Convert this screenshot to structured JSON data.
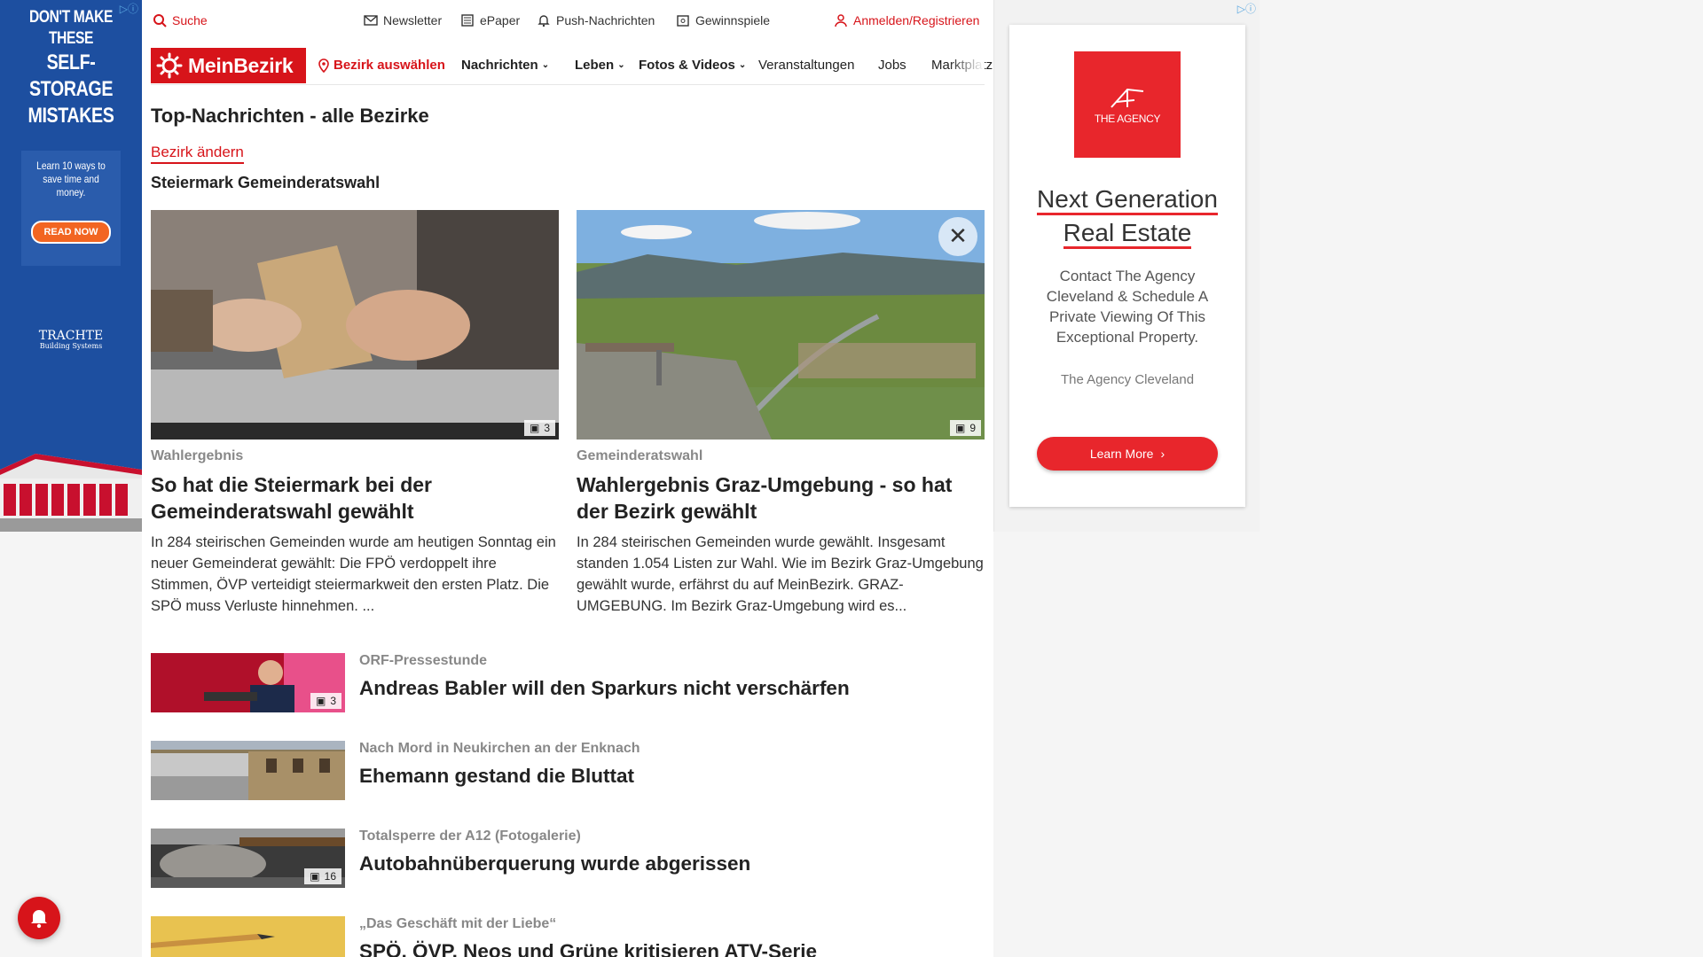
{
  "left_ad": {
    "adchoice": "▷ⓘ",
    "headline_line1": "DON'T MAKE THESE",
    "headline_line2": "SELF-STORAGE",
    "headline_line3": "MISTAKES",
    "promo_text": "Learn 10 ways to save time and money.",
    "cta": "READ NOW",
    "brand": "TRACHTE",
    "brand_sub": "Building Systems"
  },
  "topbar": {
    "search": "Suche",
    "newsletter": "Newsletter",
    "epaper": "ePaper",
    "push": "Push-Nachrichten",
    "gewinnspiele": "Gewinnspiele",
    "login": "Anmelden/Registrieren"
  },
  "nav": {
    "logo": "MeinBezirk",
    "bezirk": "Bezirk auswählen",
    "items": [
      "Nachrichten",
      "Leben",
      "Fotos & Videos",
      "Veranstaltungen",
      "Jobs",
      "Marktplatz"
    ]
  },
  "page": {
    "title": "Top-Nachrichten - alle Bezirke",
    "change_link": "Bezirk ändern",
    "section": "Steiermark Gemeinderatswahl"
  },
  "cards": [
    {
      "kicker": "Wahlergebnis",
      "headline": "So hat die Steiermark bei der Gemeinderatswahl gewählt",
      "teaser": "In 284 steirischen Gemeinden wurde am heutigen Sonntag ein neuer Gemeinderat gewählt: Die FPÖ verdoppelt ihre Stimmen, ÖVP verteidigt steiermarkweit den ersten Platz. Die SPÖ muss Verluste hinnehmen. ...",
      "photos": "3"
    },
    {
      "kicker": "Gemeinderatswahl",
      "headline": "Wahlergebnis Graz-Umgebung - so hat der Bezirk gewählt",
      "teaser": "In 284 steirischen Gemeinden wurde gewählt. Insgesamt standen 1.054 Listen zur Wahl. Wie im Bezirk Graz-Umgebung gewählt wurde, erfährst du auf MeinBezirk. GRAZ-UMGEBUNG. Im Bezirk Graz-Umgebung wird es...",
      "photos": "9"
    }
  ],
  "list": [
    {
      "kicker": "ORF-Pressestunde",
      "headline": "Andreas Babler will den Sparkurs nicht verschärfen",
      "photos": "3"
    },
    {
      "kicker": "Nach Mord in Neukirchen an der Enknach",
      "headline": "Ehemann gestand die Bluttat",
      "photos": ""
    },
    {
      "kicker": "Totalsperre der A12 (Fotogalerie)",
      "headline": "Autobahnüberquerung wurde abgerissen",
      "photos": "16"
    },
    {
      "kicker": "„Das Geschäft mit der Liebe“",
      "headline": "SPÖ, ÖVP, Neos und Grüne kritisieren ATV-Serie",
      "photos": ""
    }
  ],
  "right_ad": {
    "adchoice": "▷ⓘ",
    "logo_text": "THE AGENCY",
    "headline_1": "Next Generation",
    "headline_2": "Real Estate",
    "body": "Contact The Agency Cleveland & Schedule A Private Viewing Of This Exceptional Property.",
    "source": "The Agency Cleveland",
    "cta": "Learn More"
  },
  "colors": {
    "brand": "#d7141a",
    "ad_blue": "#1d4fa0",
    "agency_red": "#e8262c"
  }
}
